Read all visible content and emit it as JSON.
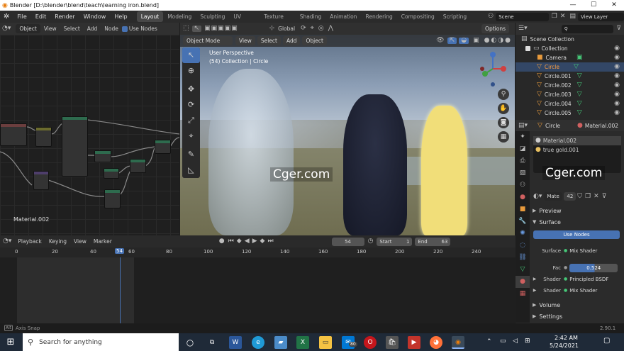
{
  "window": {
    "title": "Blender [D:\\blender\\blend\\teach\\learning iron.blend]",
    "minimize": "—",
    "maximize": "☐",
    "close": "✕"
  },
  "menu": [
    "File",
    "Edit",
    "Render",
    "Window",
    "Help"
  ],
  "workspaces": [
    "Layout",
    "Modeling",
    "Sculpting",
    "UV Editing",
    "Texture Paint",
    "Shading",
    "Animation",
    "Rendering",
    "Compositing",
    "Scripting"
  ],
  "active_workspace": "Layout",
  "scene": {
    "name": "Scene",
    "view_layer": "View Layer"
  },
  "node_editor": {
    "header": {
      "object": "Object",
      "view": "View",
      "select": "Select",
      "add": "Add",
      "node": "Node",
      "use_nodes": "Use Nodes"
    },
    "material_label": "Material.002"
  },
  "viewport_header": {
    "mode": "Object Mode",
    "view": "View",
    "select": "Select",
    "add": "Add",
    "object": "Object",
    "orientation": "Global",
    "options": "Options"
  },
  "viewport": {
    "perspective": "User Perspective",
    "collection": "(54) Collection | Circle",
    "watermark": "Cger.com"
  },
  "outliner": {
    "title": "Scene Collection",
    "items": [
      {
        "name": "Collection",
        "icon": "collection-icon"
      },
      {
        "name": "Camera",
        "icon": "camera-icon"
      },
      {
        "name": "Circle",
        "icon": "mesh-icon"
      },
      {
        "name": "Circle.001",
        "icon": "mesh-icon"
      },
      {
        "name": "Circle.002",
        "icon": "mesh-icon"
      },
      {
        "name": "Circle.003",
        "icon": "mesh-icon"
      },
      {
        "name": "Circle.004",
        "icon": "mesh-icon"
      },
      {
        "name": "Circle.005",
        "icon": "mesh-icon"
      }
    ]
  },
  "properties": {
    "object": "Circle",
    "material": "Material.002",
    "slots": [
      "Material.002",
      "true gold.001"
    ],
    "mat_name": "Mate",
    "mat_users": "42",
    "watermark": "Cger.com",
    "preview": "Preview",
    "surface": "Surface",
    "use_nodes": "Use Nodes",
    "rows": [
      {
        "label": "Surface",
        "value": "Mix Shader"
      },
      {
        "label": "Fac",
        "value": "0.524"
      },
      {
        "label": "Shader",
        "value": "Principled BSDF"
      },
      {
        "label": "Shader",
        "value": "Mix Shader"
      }
    ],
    "volume": "Volume",
    "settings": "Settings"
  },
  "timeline": {
    "playback": "Playback",
    "keying": "Keying",
    "view": "View",
    "marker": "Marker",
    "current_frame": "54",
    "start_label": "Start",
    "start": "1",
    "end_label": "End",
    "end": "63",
    "ticks": [
      "0",
      "20",
      "40",
      "54",
      "60",
      "80",
      "100",
      "120",
      "140",
      "160",
      "180",
      "200",
      "220",
      "240"
    ]
  },
  "status": {
    "left": "Axis Snap",
    "version": "2.90.1"
  },
  "taskbar": {
    "search_placeholder": "Search for anything",
    "time": "2:42 AM",
    "date": "5/24/2021",
    "mail_badge": "80"
  },
  "colors": {
    "accent_blue": "#4772b3",
    "active_orange": "#ff8c00",
    "mesh_green": "#46c878",
    "taskbar": "#1f2a38"
  }
}
